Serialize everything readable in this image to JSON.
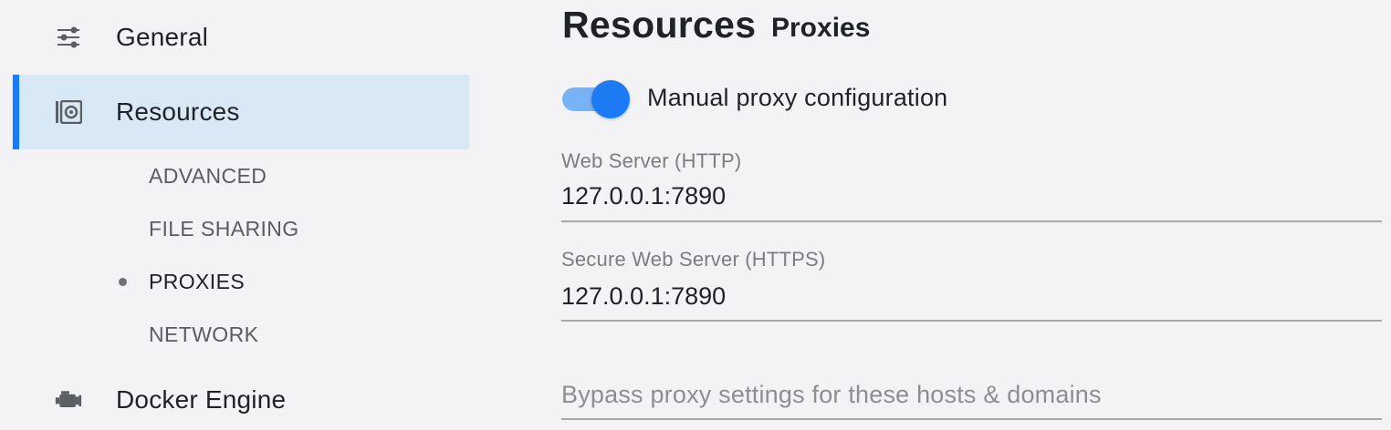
{
  "sidebar": {
    "items": [
      {
        "label": "General",
        "icon": "sliders-icon"
      },
      {
        "label": "Resources",
        "icon": "resources-icon"
      },
      {
        "label": "Docker Engine",
        "icon": "engine-icon"
      }
    ],
    "subitems": [
      {
        "label": "ADVANCED"
      },
      {
        "label": "FILE SHARING"
      },
      {
        "label": "PROXIES"
      },
      {
        "label": "NETWORK"
      }
    ],
    "active_item": "Resources",
    "current_subitem": "PROXIES"
  },
  "main": {
    "title": "Resources",
    "subtitle": "Proxies",
    "manual_proxy": {
      "label": "Manual proxy configuration",
      "enabled": true
    },
    "http": {
      "label": "Web Server (HTTP)",
      "value": "127.0.0.1:7890"
    },
    "https": {
      "label": "Secure Web Server (HTTPS)",
      "value": "127.0.0.1:7890"
    },
    "bypass": {
      "placeholder": "Bypass proxy settings for these hosts & domains"
    }
  },
  "colors": {
    "accent": "#1c7bf2",
    "active_bg": "#d8e8f5",
    "toggle_track": "#78b3f5",
    "background": "#f3f3f6"
  }
}
